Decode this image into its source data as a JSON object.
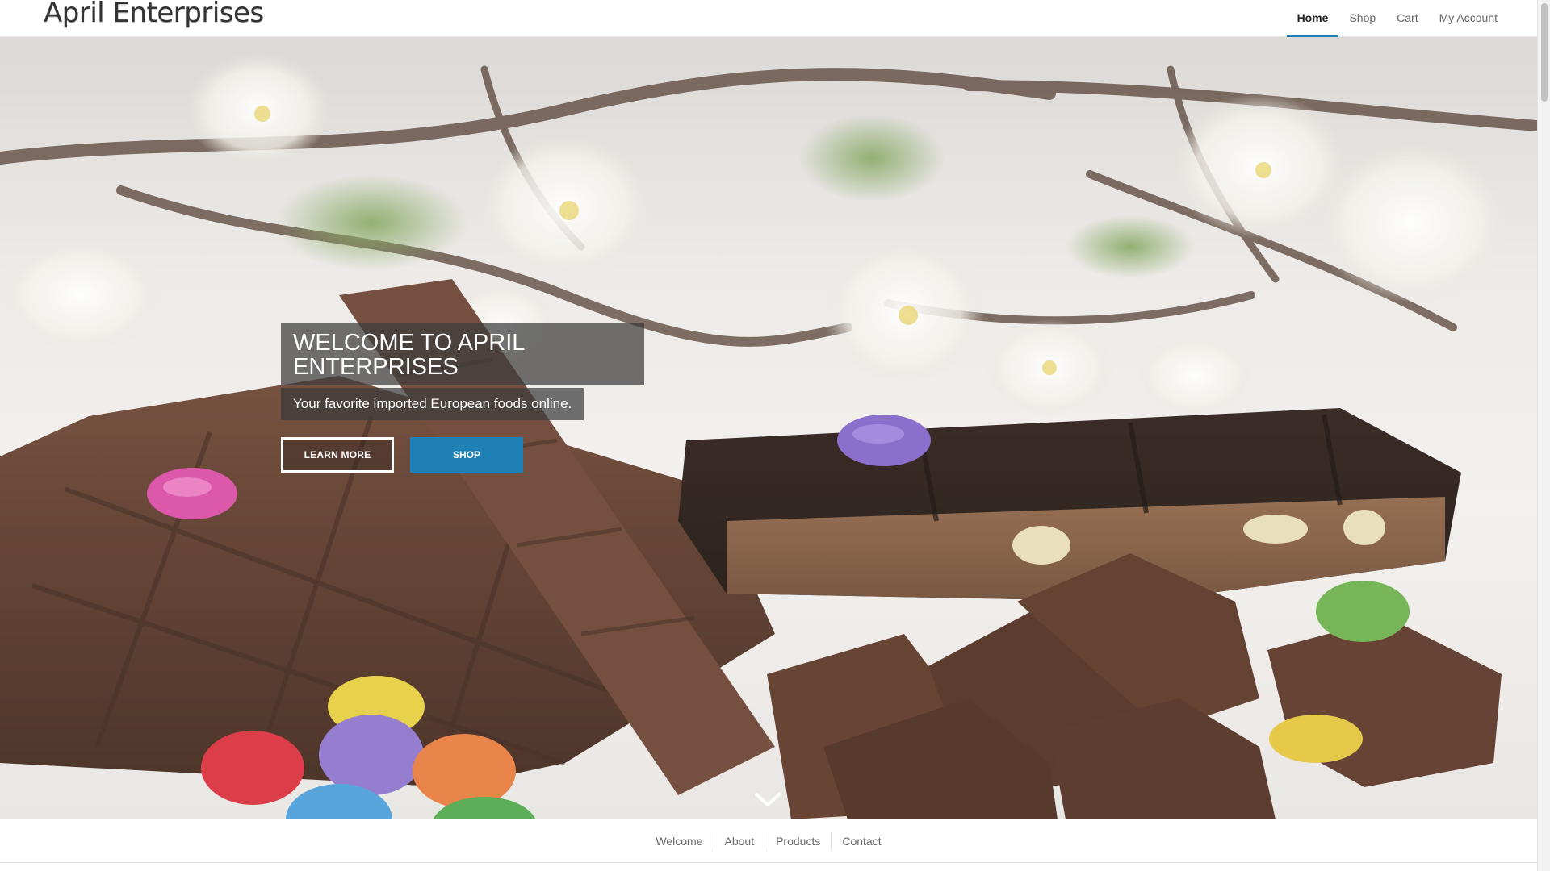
{
  "header": {
    "site_title": "April Enterprises",
    "nav": [
      {
        "label": "Home",
        "active": true
      },
      {
        "label": "Shop",
        "active": false
      },
      {
        "label": "Cart",
        "active": false
      },
      {
        "label": "My Account",
        "active": false
      }
    ]
  },
  "hero": {
    "title": "WELCOME TO APRIL ENTERPRISES",
    "subtitle": "Your favorite imported European foods online.",
    "learn_more_label": "LEARN MORE",
    "shop_label": "SHOP",
    "scroll_icon": "chevron-down-icon",
    "image_alt": "Chocolate bars with colorful candies and white blossoms"
  },
  "section_nav": [
    {
      "label": "Welcome"
    },
    {
      "label": "About"
    },
    {
      "label": "Products"
    },
    {
      "label": "Contact"
    }
  ],
  "colors": {
    "accent": "#1e80b5",
    "chocolate": "#5a3622",
    "dark_chocolate": "#2a1a14",
    "header_bg": "#ffffff"
  }
}
